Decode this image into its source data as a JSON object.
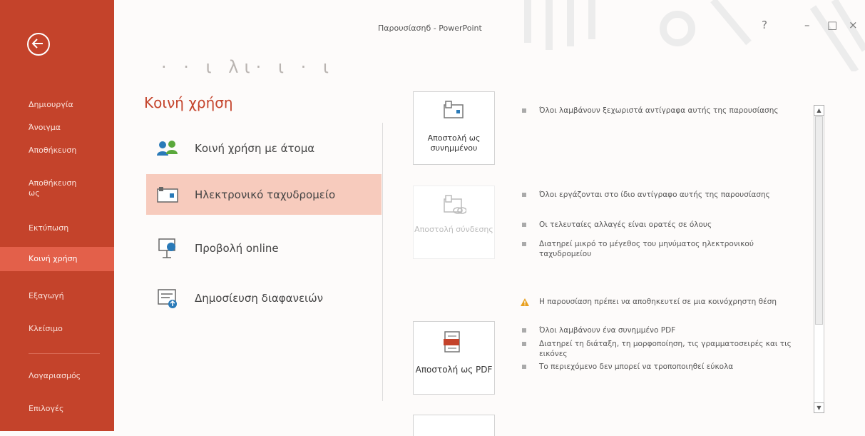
{
  "window": {
    "title": "Παρουσίασηб - PowerPoint",
    "help": "?",
    "minimize": "–",
    "restore": "□",
    "close": "×"
  },
  "sidebar": {
    "back_icon": "back-arrow-icon",
    "items": [
      {
        "label": "Δημιουργία"
      },
      {
        "label": "Άνοιγμα"
      },
      {
        "label": "Αποθήκευση"
      },
      {
        "label": "Αποθήκευση ως"
      },
      {
        "label": "Εκτύπωση"
      },
      {
        "label": "Κοινή χρήση",
        "active": true
      },
      {
        "label": "Εξαγωγή"
      },
      {
        "label": "Κλείσιμο"
      },
      {
        "label": "Λογαριασμός"
      },
      {
        "label": "Επιλογές"
      }
    ]
  },
  "main": {
    "faded_heading": "· · ι λι·  ι · ι",
    "heading": "Κοινή χρήση",
    "options": [
      {
        "label": "Κοινή χρήση με άτομα",
        "icon": "people-icon"
      },
      {
        "label": "Ηλεκτρονικό ταχυδρομείο",
        "icon": "email-icon",
        "selected": true
      },
      {
        "label": "Προβολή online",
        "icon": "present-online-icon"
      },
      {
        "label": "Δημοσίευση διαφανειών",
        "icon": "publish-slides-icon"
      }
    ]
  },
  "detail": {
    "attachment": {
      "label": "Αποστολή ως συνημμένου",
      "bullets": [
        "Όλοι λαμβάνουν ξεχωριστά αντίγραφα αυτής της παρουσίασης"
      ]
    },
    "link": {
      "label": "Αποστολή σύνδεσης",
      "disabled": true,
      "bullets": [
        "Όλοι εργάζονται στο ίδιο αντίγραφο αυτής της παρουσίασης",
        "Οι τελευταίες αλλαγές είναι ορατές σε όλους",
        "Διατηρεί μικρό το μέγεθος του μηνύματος ηλεκτρονικού ταχυδρομείου"
      ],
      "warning": "Η παρουσίαση πρέπει να αποθηκευτεί σε μια κοινόχρηστη θέση"
    },
    "pdf": {
      "label": "Αποστολή ως PDF",
      "bullets": [
        "Όλοι λαμβάνουν ένα συνημμένο PDF",
        "Διατηρεί τη διάταξη, τη μορφοποίηση, τις γραμματοσειρές και τις εικόνες",
        "Το περιεχόμενο δεν μπορεί να τροποποιηθεί εύκολα"
      ]
    }
  },
  "colors": {
    "accent": "#c4432b",
    "active_nav": "#e3604a",
    "selected_option": "#f7cbbd",
    "warning": "#e8a020"
  }
}
